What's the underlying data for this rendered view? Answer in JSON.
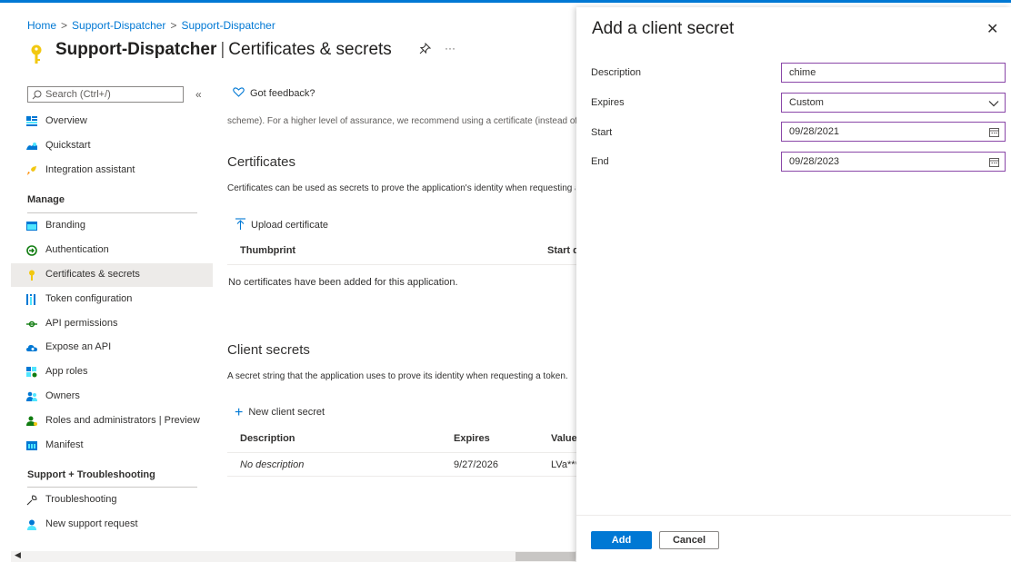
{
  "colors": {
    "accent": "#0078d4",
    "focus_border": "#8a47a8",
    "active_nav": "#edebe9"
  },
  "breadcrumb": {
    "items": [
      "Home",
      "Support-Dispatcher",
      "Support-Dispatcher"
    ]
  },
  "header": {
    "app_name": "Support-Dispatcher",
    "separator": "|",
    "page": "Certificates & secrets",
    "pin_icon": "pin-icon",
    "more": "···"
  },
  "sidebar": {
    "search_placeholder": "Search (Ctrl+/)",
    "collapse": "«",
    "items": [
      {
        "label": "Overview",
        "icon": "overview-icon"
      },
      {
        "label": "Quickstart",
        "icon": "quickstart-icon"
      },
      {
        "label": "Integration assistant",
        "icon": "rocket-icon"
      },
      {
        "label": "Branding",
        "icon": "branding-icon"
      },
      {
        "label": "Authentication",
        "icon": "authentication-icon"
      },
      {
        "label": "Certificates & secrets",
        "icon": "key-icon",
        "active": true
      },
      {
        "label": "Token configuration",
        "icon": "token-icon"
      },
      {
        "label": "API permissions",
        "icon": "api-permissions-icon"
      },
      {
        "label": "Expose an API",
        "icon": "cloud-icon"
      },
      {
        "label": "App roles",
        "icon": "app-roles-icon"
      },
      {
        "label": "Owners",
        "icon": "owners-icon"
      },
      {
        "label": "Roles and administrators | Preview",
        "icon": "roles-icon"
      },
      {
        "label": "Manifest",
        "icon": "manifest-icon"
      },
      {
        "label": "Troubleshooting",
        "icon": "wrench-icon"
      },
      {
        "label": "New support request",
        "icon": "support-icon"
      }
    ],
    "sections": [
      "Manage",
      "Support + Troubleshooting"
    ]
  },
  "main": {
    "feedback": "Got feedback?",
    "cutoff_text": "scheme). For a higher level of assurance, we recommend using a certificate (instead of a client secret)",
    "certificates": {
      "heading": "Certificates",
      "description": "Certificates can be used as secrets to prove the application's identity when requesting a token.",
      "upload": "Upload certificate",
      "columns": [
        "Thumbprint",
        "Start d"
      ],
      "empty": "No certificates have been added for this application."
    },
    "secrets": {
      "heading": "Client secrets",
      "description": "A secret string that the application uses to prove its identity when requesting a token.",
      "new": "New client secret",
      "columns": [
        "Description",
        "Expires",
        "Value"
      ],
      "rows": [
        {
          "description": "No description",
          "expires": "9/27/2026",
          "value": "LVa***"
        }
      ]
    }
  },
  "panel": {
    "title": "Add a client secret",
    "close": "✕",
    "fields": {
      "description": {
        "label": "Description",
        "value": "chime"
      },
      "expires": {
        "label": "Expires",
        "value": "Custom"
      },
      "start": {
        "label": "Start",
        "value": "09/28/2021"
      },
      "end": {
        "label": "End",
        "value": "09/28/2023"
      }
    },
    "add_label": "Add",
    "cancel_label": "Cancel"
  }
}
